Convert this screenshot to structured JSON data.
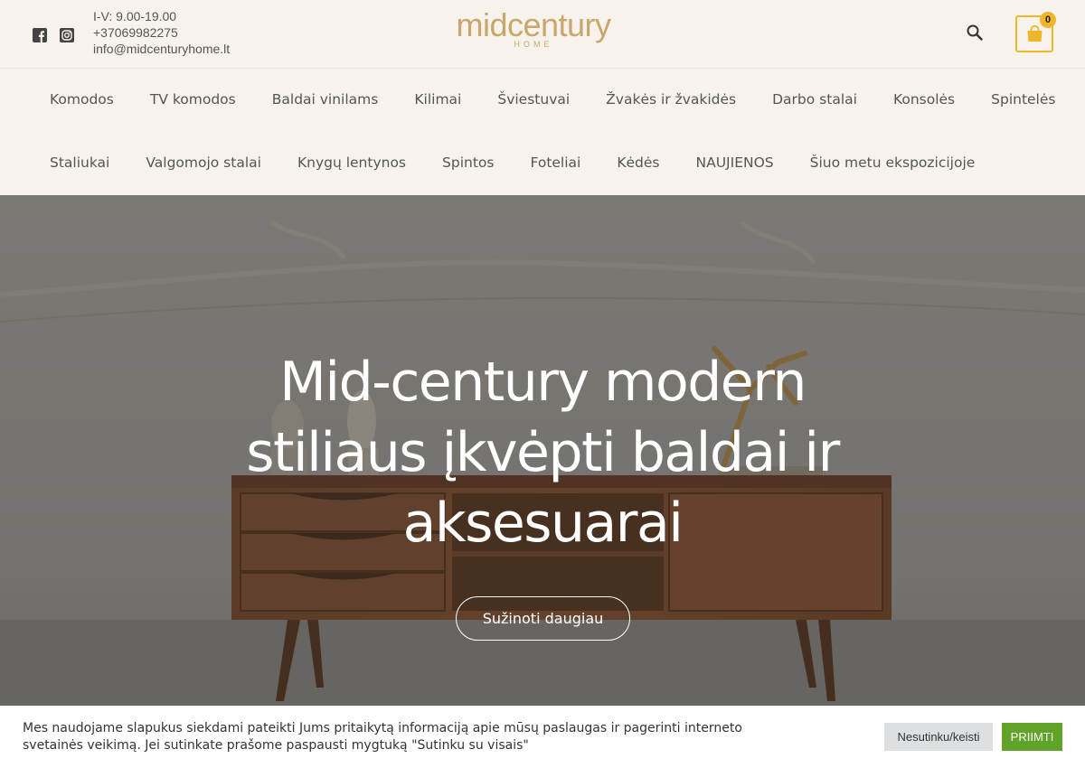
{
  "header": {
    "hours": "I-V: 9.00-19.00",
    "phone": "+37069982275",
    "email": "info@midcenturyhome.lt",
    "logo_word": "midcentury",
    "logo_sub": "HOME",
    "cart_count": "0",
    "icons": [
      "facebook-icon",
      "instagram-icon",
      "search-icon",
      "shopping-bag-icon"
    ],
    "accent_color": "#f0b62b"
  },
  "nav": {
    "row1": [
      "Komodos",
      "TV komodos",
      "Baldai vinilams",
      "Kilimai",
      "Šviestuvai",
      "Žvakės ir žvakidės",
      "Darbo stalai",
      "Konsolės",
      "Spintelės"
    ],
    "row2": [
      "Staliukai",
      "Valgomojo stalai",
      "Knygų lentynos",
      "Spintos",
      "Foteliai",
      "Kėdės",
      "NAUJIENOS",
      "Šiuo metu ekspozicijoje"
    ]
  },
  "hero": {
    "title_line1": "Mid-century modern",
    "title_line2": "stiliaus įkvėpti baldai ir",
    "title_line3": "aksesuarai",
    "button": "Sužinoti daugiau"
  },
  "cookie": {
    "text_line1": "Mes naudojame slapukus siekdami pateikti Jums pritaikytą informaciją apie mūsų paslaugas ir pagerinti interneto",
    "text_line2": "svetainės veikimą. Jei sutinkate prašome paspausti mygtuką \"Sutinku su visais\"",
    "decline": "Nesutinku/keisti",
    "accept": "PRIIMTI",
    "accept_color": "#61a229"
  }
}
